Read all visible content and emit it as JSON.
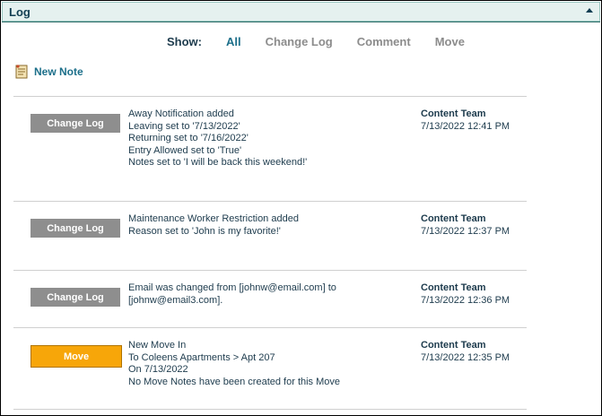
{
  "panel": {
    "title": "Log"
  },
  "filter": {
    "label": "Show:",
    "options": [
      "All",
      "Change Log",
      "Comment",
      "Move"
    ],
    "selected": "All"
  },
  "new_note": {
    "label": "New Note",
    "icon": "note-icon"
  },
  "entries": [
    {
      "type": "Change Log",
      "lines": [
        "Away Notification added",
        "Leaving set to '7/13/2022'",
        "Returning set to '7/16/2022'",
        "Entry Allowed set to 'True'",
        "Notes set to 'I will be back this weekend!'"
      ],
      "author": "Content Team",
      "timestamp": "7/13/2022 12:41 PM"
    },
    {
      "type": "Change Log",
      "lines": [
        "Maintenance Worker Restriction added",
        "Reason set to 'John is my favorite!'"
      ],
      "author": "Content Team",
      "timestamp": "7/13/2022 12:37 PM"
    },
    {
      "type": "Change Log",
      "lines": [
        "Email was changed from [johnw@email.com] to",
        "[johnw@email3.com]."
      ],
      "author": "Content Team",
      "timestamp": "7/13/2022 12:36 PM"
    },
    {
      "type": "Move",
      "lines": [
        "New Move In",
        "To Coleens Apartments > Apt 207",
        "On 7/13/2022",
        "No Move Notes have been created for this Move"
      ],
      "author": "Content Team",
      "timestamp": "7/13/2022 12:35 PM"
    }
  ],
  "colors": {
    "header_bg": "#e5f1ef",
    "accent": "#1c6f8a",
    "change_log_tag": "#8e8e8e",
    "move_tag": "#f7a609",
    "text": "#1d3b4d"
  }
}
